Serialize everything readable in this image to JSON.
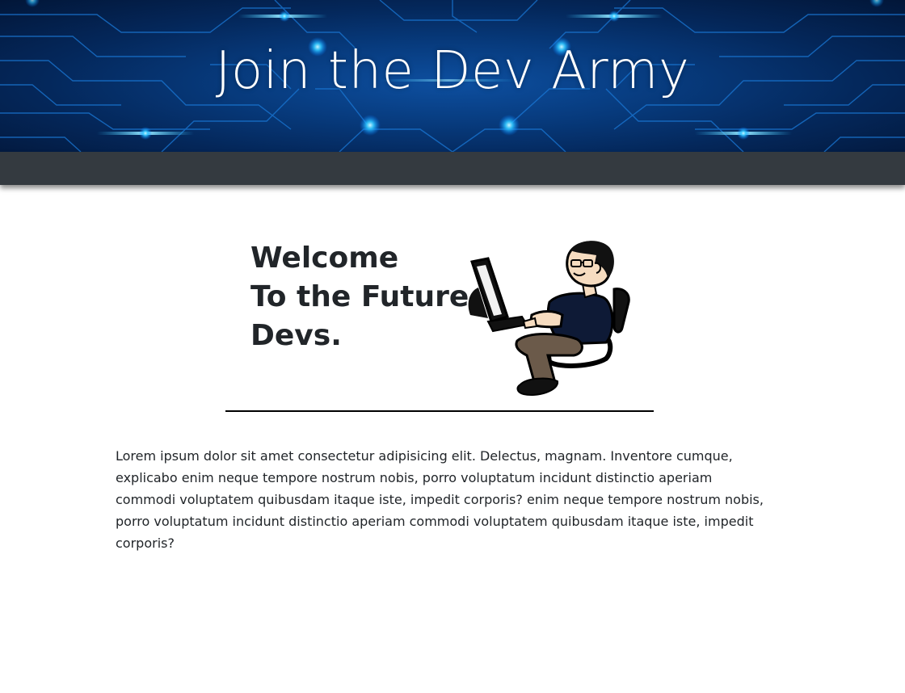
{
  "banner": {
    "title": "Join the Dev Army"
  },
  "hero": {
    "welcome_lines": [
      "Welcome",
      "To the Future",
      "Devs."
    ]
  },
  "illustration": {
    "icon": "developer-at-computer-icon"
  },
  "content": {
    "paragraph": "Lorem ipsum dolor sit amet consectetur adipisicing elit. Delectus, magnam. Inventore cumque, explicabo enim neque tempore nostrum nobis, porro voluptatum incidunt distinctio aperiam commodi voluptatem quibusdam itaque iste, impedit corporis? enim neque tempore nostrum nobis, porro voluptatum incidunt distinctio aperiam commodi voluptatem quibusdam itaque iste, impedit corporis?"
  },
  "colors": {
    "banner_blue": "#073a7c",
    "navbar": "#343a40",
    "text": "#212529"
  }
}
